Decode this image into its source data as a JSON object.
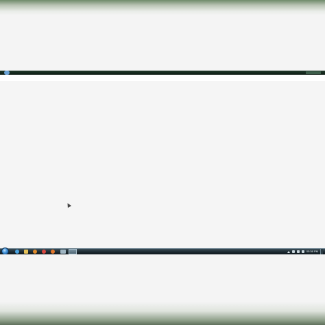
{
  "taskbar": {
    "start_icon": "windows-start-orb",
    "pinned": [
      {
        "name": "internet-explorer",
        "icon": "ie-icon"
      },
      {
        "name": "windows-explorer",
        "icon": "folder-icon"
      },
      {
        "name": "media-player",
        "icon": "media-player-icon"
      },
      {
        "name": "chrome",
        "icon": "chrome-icon"
      },
      {
        "name": "firefox",
        "icon": "firefox-icon"
      },
      {
        "name": "app",
        "icon": "app-icon"
      }
    ],
    "tray": {
      "clock": "05:36 PM"
    }
  },
  "colors": {
    "taskbar": "#1c2a31",
    "desktop": "#f5f5f5",
    "start_orb": "#3d8fd6"
  }
}
